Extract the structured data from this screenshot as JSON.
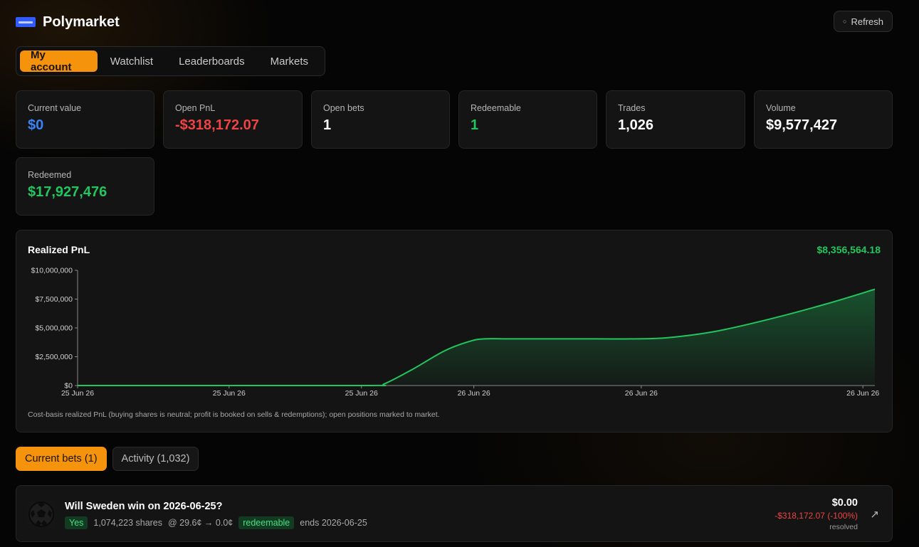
{
  "header": {
    "brand": "Polymarket",
    "refresh_label": "Refresh",
    "refresh_icon": "refresh-icon"
  },
  "tabs": [
    {
      "label": "My account",
      "active": true
    },
    {
      "label": "Watchlist",
      "active": false
    },
    {
      "label": "Leaderboards",
      "active": false
    },
    {
      "label": "Markets",
      "active": false
    }
  ],
  "stats": [
    {
      "label": "Current value",
      "value": "$0",
      "tone": "blue"
    },
    {
      "label": "Open PnL",
      "value": "-$318,172.07",
      "tone": "red"
    },
    {
      "label": "Open bets",
      "value": "1",
      "tone": "white"
    },
    {
      "label": "Redeemable",
      "value": "1",
      "tone": "green"
    },
    {
      "label": "Trades",
      "value": "1,026",
      "tone": "white"
    },
    {
      "label": "Volume",
      "value": "$9,577,427",
      "tone": "white"
    },
    {
      "label": "Redeemed",
      "value": "$17,927,476",
      "tone": "green"
    }
  ],
  "chart": {
    "title": "Realized PnL",
    "total": "$8,356,564.18",
    "note": "Cost-basis realized PnL (buying shares is neutral; profit is booked on sells & redemptions); open positions marked to market."
  },
  "chart_data": {
    "type": "area",
    "title": "Realized PnL",
    "y_tick_labels": [
      "$0",
      "$2,500,000",
      "$5,000,000",
      "$7,500,000",
      "$10,000,000"
    ],
    "y_ticks": [
      0,
      2500000,
      5000000,
      7500000,
      10000000
    ],
    "ylim": [
      0,
      10000000
    ],
    "x_tick_labels": [
      "25 Jun 26",
      "25 Jun 26",
      "25 Jun 26",
      "26 Jun 26",
      "26 Jun 26",
      "26 Jun 26"
    ],
    "series": [
      {
        "values": [
          [
            0,
            0
          ],
          [
            0.2,
            0
          ],
          [
            0.37,
            0
          ],
          [
            0.385,
            150000
          ],
          [
            0.42,
            1400000
          ],
          [
            0.46,
            3000000
          ],
          [
            0.49,
            3800000
          ],
          [
            0.51,
            4050000
          ],
          [
            0.55,
            4050000
          ],
          [
            0.65,
            4050000
          ],
          [
            0.7,
            4050000
          ],
          [
            0.74,
            4150000
          ],
          [
            0.8,
            4700000
          ],
          [
            0.87,
            5800000
          ],
          [
            0.94,
            7100000
          ],
          [
            1.0,
            8356564.18
          ]
        ]
      }
    ],
    "grid": false,
    "colors": {
      "line": "#22c55e",
      "fill": "#22c55e"
    }
  },
  "subtabs": [
    {
      "label": "Current bets (1)",
      "active": true
    },
    {
      "label": "Activity (1,032)",
      "active": false
    }
  ],
  "bet": {
    "title": "Will Sweden win on 2026-06-25?",
    "outcome": "Yes",
    "shares": "1,074,223 shares",
    "price": "@ 29.6¢ → 0.0¢",
    "status_badge": "redeemable",
    "ends": "ends 2026-06-25",
    "value": "$0.00",
    "pnl": "-$318,172.07 (-100%)",
    "state": "resolved",
    "icon": "soccer-ball-icon",
    "link_icon": "external-link-icon"
  }
}
